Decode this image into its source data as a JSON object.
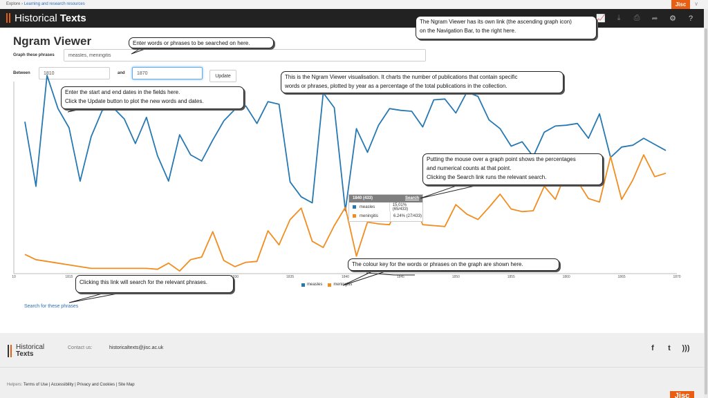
{
  "topbar": {
    "prefix": "Explore",
    "sep": "›",
    "link": "Learning and research resources",
    "jisc": "Jisc",
    "arrow": "∨"
  },
  "nav": {
    "brand_left": "Historical",
    "brand_right": "Texts",
    "icons": [
      {
        "name": "ngram-graph-icon",
        "glyph": "📈"
      },
      {
        "name": "download-icon",
        "glyph": "⤓"
      },
      {
        "name": "print-icon",
        "glyph": "⎙"
      },
      {
        "name": "share-icon",
        "glyph": "➦"
      },
      {
        "name": "gear-icon",
        "glyph": "⚙"
      },
      {
        "name": "help-icon",
        "glyph": "?"
      }
    ]
  },
  "page": {
    "title": "Ngram Viewer"
  },
  "form": {
    "phrases_label": "Graph these phrases",
    "phrases_value": "measles, meningitis",
    "between_label": "Between",
    "start_value": "1810",
    "and_label": "and",
    "end_value": "1870",
    "update_label": "Update"
  },
  "callouts": {
    "nav_link": [
      "The Ngram Viewer has its own link (the ascending graph icon)",
      "on the Navigation Bar, to the right here."
    ],
    "enter_words": [
      "Enter words or phrases to be searched on here."
    ],
    "visualisation": [
      "This is the Ngram Viewer visualisation. It charts the number of publications that contain specific",
      " words or phrases, plotted by year as a percentage of the total publications in the collection."
    ],
    "dates": [
      "Enter the start and end dates in the fields here.",
      "Click the Update button to plot the new words and dates."
    ],
    "hover": [
      "Putting the mouse over a graph point shows the percentages",
      "and numerical counts at that point.",
      "Clicking the Search link runs the relevant search."
    ],
    "colour_key": [
      "The colour key for the words or phrases on the graph are shown here."
    ],
    "search_link": [
      "Clicking this link will search for the relevant phrases."
    ]
  },
  "tooltip": {
    "header": "1840 (433)",
    "link": "Search",
    "rows": [
      {
        "name": "measles",
        "value": "15.01% (65/433)",
        "color": "#2678b2"
      },
      {
        "name": "meningitis",
        "value": "6.24% (27/433)",
        "color": "#f28c1e"
      }
    ]
  },
  "search_link": "Search for these phrases",
  "chart_data": {
    "type": "line",
    "xlim": [
      1810,
      1870
    ],
    "xticks": [
      "10",
      "1815",
      "1820",
      "1825",
      "1830",
      "1835",
      "1840",
      "1845",
      "1850",
      "1855",
      "1860",
      "1865",
      "1870"
    ],
    "xtick_values": [
      1810,
      1815,
      1820,
      1825,
      1830,
      1835,
      1840,
      1845,
      1850,
      1855,
      1860,
      1865,
      1870
    ],
    "ylim": [
      0,
      22
    ],
    "grid": false,
    "legend": "bottom",
    "series": [
      {
        "name": "measles",
        "color": "#2678b2",
        "x": [
          1811,
          1812,
          1813,
          1814,
          1815,
          1816,
          1817,
          1818,
          1819,
          1820,
          1821,
          1822,
          1823,
          1824,
          1825,
          1826,
          1827,
          1828,
          1829,
          1830,
          1831,
          1832,
          1833,
          1834,
          1835,
          1836,
          1837,
          1838,
          1839,
          1840,
          1841,
          1842,
          1843,
          1844,
          1845,
          1846,
          1847,
          1848,
          1849,
          1850,
          1851,
          1852,
          1853,
          1854,
          1855,
          1856,
          1857,
          1858,
          1859,
          1860,
          1861,
          1862,
          1863,
          1864,
          1865,
          1866,
          1867,
          1868,
          1869
        ],
        "y": [
          17.4,
          10.0,
          22.7,
          18.9,
          16.7,
          10.6,
          15.7,
          18.7,
          19.0,
          17.7,
          14.9,
          17.9,
          13.5,
          10.6,
          15.9,
          13.6,
          12.9,
          15.3,
          17.5,
          18.8,
          19.2,
          17.2,
          19.7,
          19.4,
          10.5,
          8.8,
          8.1,
          20.7,
          19.0,
          7.2,
          16.6,
          13.9,
          17.0,
          18.9,
          18.7,
          18.6,
          16.8,
          19.9,
          20.0,
          18.4,
          20.8,
          20.3,
          17.6,
          16.6,
          14.6,
          15.1,
          13.4,
          16.2,
          16.9,
          17.0,
          17.2,
          15.5,
          18.3,
          13.3,
          14.5,
          14.7,
          15.5,
          14.8,
          14.1
        ]
      },
      {
        "name": "meningitis",
        "color": "#f28c1e",
        "x": [
          1811,
          1812,
          1813,
          1814,
          1815,
          1816,
          1817,
          1818,
          1819,
          1820,
          1821,
          1822,
          1823,
          1824,
          1825,
          1826,
          1827,
          1828,
          1829,
          1830,
          1831,
          1832,
          1833,
          1834,
          1835,
          1836,
          1837,
          1838,
          1839,
          1840,
          1841,
          1842,
          1843,
          1844,
          1845,
          1846,
          1847,
          1848,
          1849,
          1850,
          1851,
          1852,
          1853,
          1854,
          1855,
          1856,
          1857,
          1858,
          1859,
          1860,
          1861,
          1862,
          1863,
          1864,
          1865,
          1866,
          1867,
          1868,
          1869
        ],
        "y": [
          2.2,
          1.6,
          1.4,
          1.2,
          1.0,
          0.8,
          0.6,
          0.6,
          0.6,
          0.6,
          0.6,
          0.6,
          0.5,
          1.2,
          0.3,
          1.6,
          1.9,
          4.8,
          1.5,
          0.8,
          1.3,
          1.4,
          4.9,
          3.3,
          6.2,
          7.5,
          3.7,
          3.0,
          5.5,
          7.6,
          2.0,
          5.9,
          5.7,
          5.6,
          8.7,
          8.9,
          5.6,
          5.5,
          5.4,
          7.9,
          6.8,
          6.2,
          7.6,
          9.1,
          7.4,
          7.1,
          7.2,
          10.0,
          8.5,
          11.7,
          10.6,
          8.6,
          8.2,
          13.4,
          8.5,
          10.7,
          13.6,
          11.1,
          11.5
        ]
      }
    ]
  },
  "footer": {
    "logo_top": "Historical",
    "logo_bottom": "Texts",
    "contact_label": "Contact us:",
    "contact_value": "historicaltexts@jisc.ac.uk",
    "social": [
      "f",
      "t",
      ")))"
    ],
    "helpers_label": "Helpers:",
    "helpers_links": "Terms of Use | Accessibility | Privacy and Cookies | Site Map",
    "jisc": "Jisc"
  }
}
